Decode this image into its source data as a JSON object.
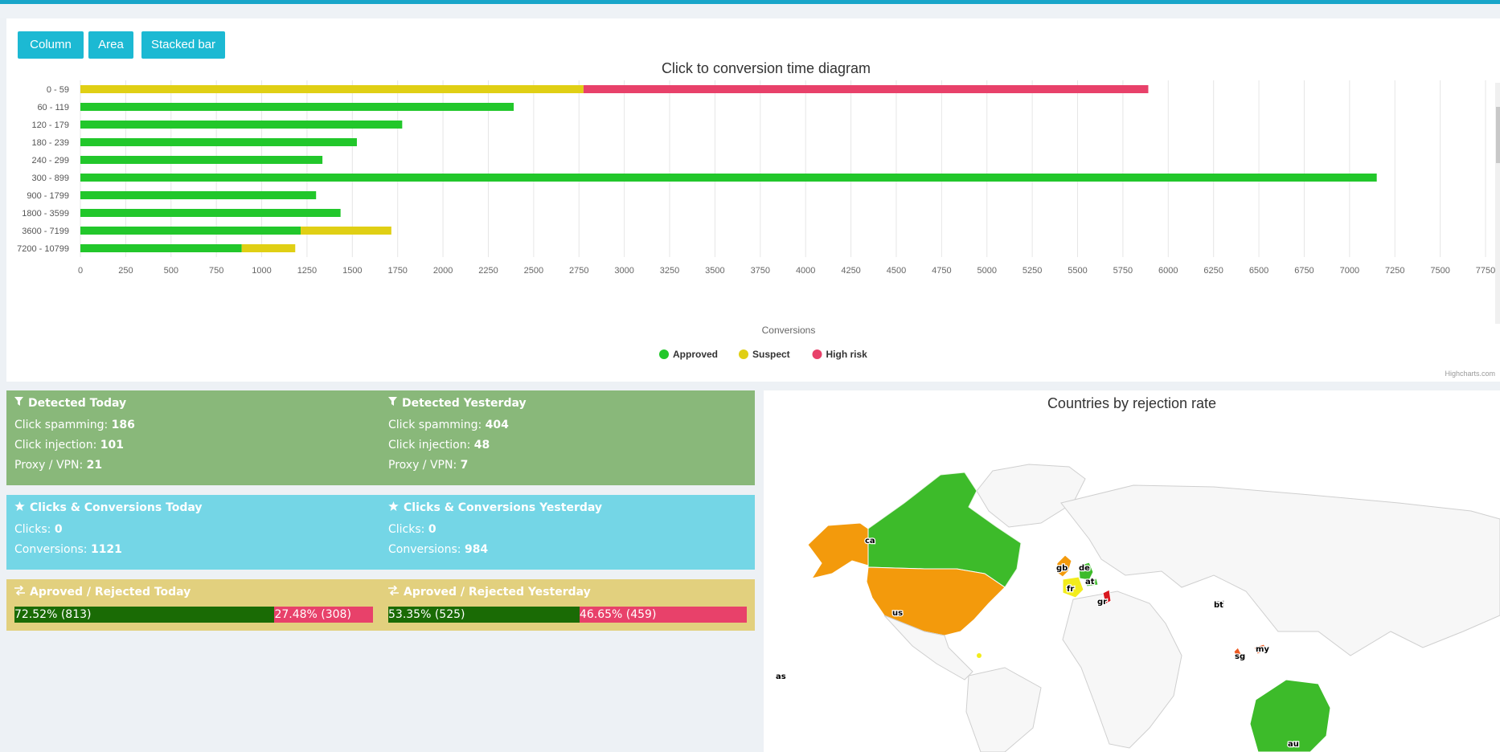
{
  "buttons": {
    "column": "Column",
    "area": "Area",
    "stacked": "Stacked bar"
  },
  "chart_data": {
    "type": "bar",
    "orientation": "horizontal",
    "stacked": true,
    "title": "Click to conversion time diagram",
    "xlabel": "Conversions",
    "categories": [
      "0 - 59",
      "60 - 119",
      "120 - 179",
      "180 - 239",
      "240 - 299",
      "300 - 899",
      "900 - 1799",
      "1800 - 3599",
      "3600 - 7199",
      "7200 - 10799"
    ],
    "series": [
      {
        "name": "Approved",
        "color": "#22c72b",
        "values": [
          0,
          2390,
          1775,
          1525,
          1335,
          7150,
          1300,
          1435,
          1215,
          890
        ]
      },
      {
        "name": "Suspect",
        "color": "#e0cf14",
        "values": [
          2775,
          0,
          0,
          0,
          0,
          0,
          0,
          0,
          500,
          295
        ]
      },
      {
        "name": "High risk",
        "color": "#e8416a",
        "values": [
          3115,
          0,
          0,
          0,
          0,
          0,
          0,
          0,
          0,
          0
        ]
      }
    ],
    "xlim": [
      0,
      7750
    ],
    "xticks": [
      "0",
      "250",
      "500",
      "750",
      "1000",
      "1250",
      "1500",
      "1750",
      "2000",
      "2250",
      "2500",
      "2750",
      "3000",
      "3250",
      "3500",
      "3750",
      "4000",
      "4250",
      "4500",
      "4750",
      "5000",
      "5250",
      "5500",
      "5750",
      "6000",
      "6250",
      "6500",
      "6750",
      "7000",
      "7250",
      "7500",
      "7750"
    ],
    "legend_position": "bottom",
    "grid": true
  },
  "credit": "Highcharts.com",
  "detected": {
    "today_title": "Detected Today",
    "yesterday_title": "Detected Yesterday",
    "today": [
      {
        "label": "Click spamming: ",
        "value": "186"
      },
      {
        "label": "Click injection: ",
        "value": "101"
      },
      {
        "label": "Proxy / VPN: ",
        "value": "21"
      }
    ],
    "yesterday": [
      {
        "label": "Click spamming: ",
        "value": "404"
      },
      {
        "label": "Click injection: ",
        "value": "48"
      },
      {
        "label": "Proxy / VPN: ",
        "value": "7"
      }
    ],
    "color": "#89b87a"
  },
  "clicks": {
    "today_title": "Clicks & Conversions Today",
    "yesterday_title": "Clicks & Conversions Yesterday",
    "today": [
      {
        "label": "Clicks: ",
        "value": "0"
      },
      {
        "label": "Conversions: ",
        "value": "1121"
      }
    ],
    "yesterday": [
      {
        "label": "Clicks: ",
        "value": "0"
      },
      {
        "label": "Conversions: ",
        "value": "984"
      }
    ],
    "color": "#74d6e6"
  },
  "approval": {
    "today_title": "Aproved / Rejected Today",
    "yesterday_title": "Aproved / Rejected Yesterday",
    "today": {
      "approved_pct": 72.52,
      "approved_label": "72.52% (813)",
      "rejected_label": "27.48% (308)"
    },
    "yesterday": {
      "approved_pct": 53.35,
      "approved_label": "53.35% (525)",
      "rejected_label": "46.65% (459)"
    },
    "color": "#e2d07e"
  },
  "map": {
    "title": "Countries by rejection rate",
    "labels": [
      "ca",
      "us",
      "gb",
      "de",
      "fr",
      "at",
      "gr",
      "bt",
      "sg",
      "my",
      "au",
      "as"
    ]
  },
  "icons": {
    "filter": "filter-icon",
    "star": "star-icon",
    "exchange": "exchange-icon"
  }
}
